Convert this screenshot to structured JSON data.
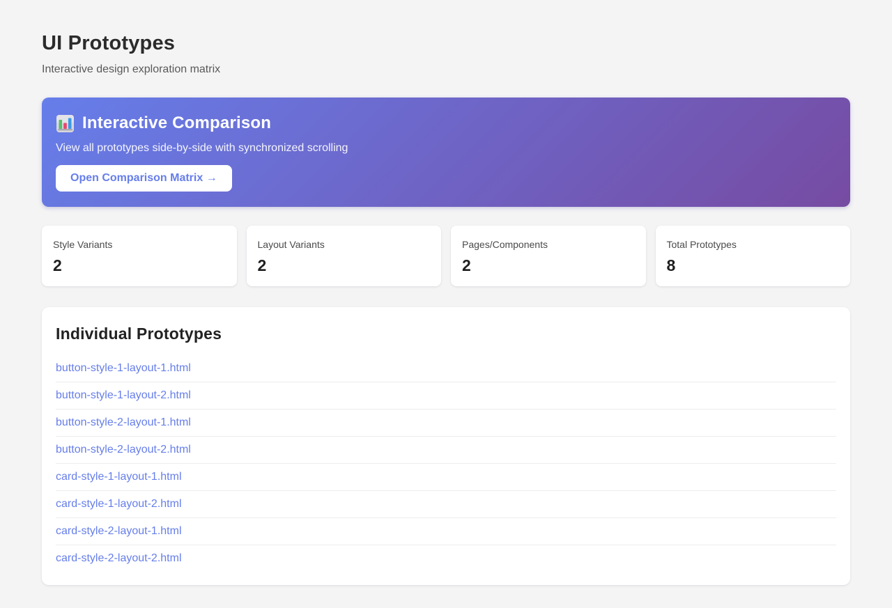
{
  "page": {
    "title": "UI Prototypes",
    "subtitle": "Interactive design exploration matrix"
  },
  "banner": {
    "icon": "bar-chart-icon",
    "title": "Interactive Comparison",
    "subtitle": "View all prototypes side-by-side with synchronized scrolling",
    "button_label": "Open Comparison Matrix →",
    "gradient_start": "#667eea",
    "gradient_end": "#764ba2",
    "button_text_color": "#667eea"
  },
  "stats": [
    {
      "label": "Style Variants",
      "value": "2"
    },
    {
      "label": "Layout Variants",
      "value": "2"
    },
    {
      "label": "Pages/Components",
      "value": "2"
    },
    {
      "label": "Total Prototypes",
      "value": "8"
    }
  ],
  "prototypes": {
    "heading": "Individual Prototypes",
    "link_color": "#667eea",
    "links": [
      "button-style-1-layout-1.html",
      "button-style-1-layout-2.html",
      "button-style-2-layout-1.html",
      "button-style-2-layout-2.html",
      "card-style-1-layout-1.html",
      "card-style-1-layout-2.html",
      "card-style-2-layout-1.html",
      "card-style-2-layout-2.html"
    ]
  }
}
